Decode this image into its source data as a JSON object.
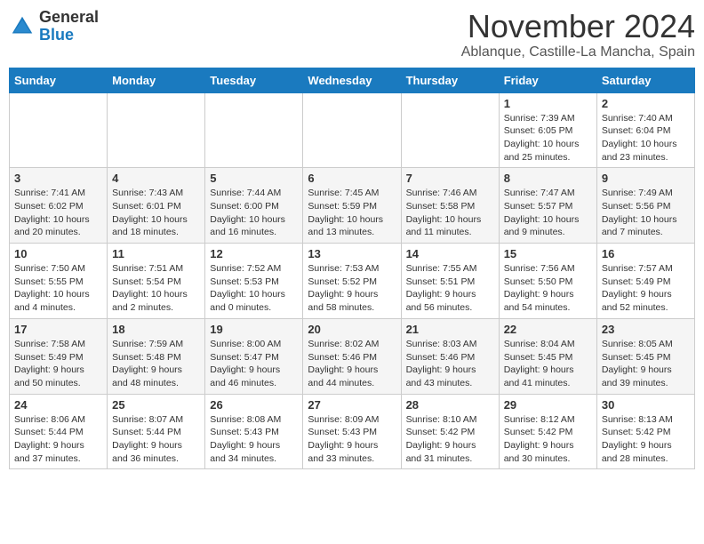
{
  "header": {
    "logo_general": "General",
    "logo_blue": "Blue",
    "month": "November 2024",
    "location": "Ablanque, Castille-La Mancha, Spain"
  },
  "weekdays": [
    "Sunday",
    "Monday",
    "Tuesday",
    "Wednesday",
    "Thursday",
    "Friday",
    "Saturday"
  ],
  "weeks": [
    [
      {
        "day": "",
        "info": ""
      },
      {
        "day": "",
        "info": ""
      },
      {
        "day": "",
        "info": ""
      },
      {
        "day": "",
        "info": ""
      },
      {
        "day": "",
        "info": ""
      },
      {
        "day": "1",
        "info": "Sunrise: 7:39 AM\nSunset: 6:05 PM\nDaylight: 10 hours and 25 minutes."
      },
      {
        "day": "2",
        "info": "Sunrise: 7:40 AM\nSunset: 6:04 PM\nDaylight: 10 hours and 23 minutes."
      }
    ],
    [
      {
        "day": "3",
        "info": "Sunrise: 7:41 AM\nSunset: 6:02 PM\nDaylight: 10 hours and 20 minutes."
      },
      {
        "day": "4",
        "info": "Sunrise: 7:43 AM\nSunset: 6:01 PM\nDaylight: 10 hours and 18 minutes."
      },
      {
        "day": "5",
        "info": "Sunrise: 7:44 AM\nSunset: 6:00 PM\nDaylight: 10 hours and 16 minutes."
      },
      {
        "day": "6",
        "info": "Sunrise: 7:45 AM\nSunset: 5:59 PM\nDaylight: 10 hours and 13 minutes."
      },
      {
        "day": "7",
        "info": "Sunrise: 7:46 AM\nSunset: 5:58 PM\nDaylight: 10 hours and 11 minutes."
      },
      {
        "day": "8",
        "info": "Sunrise: 7:47 AM\nSunset: 5:57 PM\nDaylight: 10 hours and 9 minutes."
      },
      {
        "day": "9",
        "info": "Sunrise: 7:49 AM\nSunset: 5:56 PM\nDaylight: 10 hours and 7 minutes."
      }
    ],
    [
      {
        "day": "10",
        "info": "Sunrise: 7:50 AM\nSunset: 5:55 PM\nDaylight: 10 hours and 4 minutes."
      },
      {
        "day": "11",
        "info": "Sunrise: 7:51 AM\nSunset: 5:54 PM\nDaylight: 10 hours and 2 minutes."
      },
      {
        "day": "12",
        "info": "Sunrise: 7:52 AM\nSunset: 5:53 PM\nDaylight: 10 hours and 0 minutes."
      },
      {
        "day": "13",
        "info": "Sunrise: 7:53 AM\nSunset: 5:52 PM\nDaylight: 9 hours and 58 minutes."
      },
      {
        "day": "14",
        "info": "Sunrise: 7:55 AM\nSunset: 5:51 PM\nDaylight: 9 hours and 56 minutes."
      },
      {
        "day": "15",
        "info": "Sunrise: 7:56 AM\nSunset: 5:50 PM\nDaylight: 9 hours and 54 minutes."
      },
      {
        "day": "16",
        "info": "Sunrise: 7:57 AM\nSunset: 5:49 PM\nDaylight: 9 hours and 52 minutes."
      }
    ],
    [
      {
        "day": "17",
        "info": "Sunrise: 7:58 AM\nSunset: 5:49 PM\nDaylight: 9 hours and 50 minutes."
      },
      {
        "day": "18",
        "info": "Sunrise: 7:59 AM\nSunset: 5:48 PM\nDaylight: 9 hours and 48 minutes."
      },
      {
        "day": "19",
        "info": "Sunrise: 8:00 AM\nSunset: 5:47 PM\nDaylight: 9 hours and 46 minutes."
      },
      {
        "day": "20",
        "info": "Sunrise: 8:02 AM\nSunset: 5:46 PM\nDaylight: 9 hours and 44 minutes."
      },
      {
        "day": "21",
        "info": "Sunrise: 8:03 AM\nSunset: 5:46 PM\nDaylight: 9 hours and 43 minutes."
      },
      {
        "day": "22",
        "info": "Sunrise: 8:04 AM\nSunset: 5:45 PM\nDaylight: 9 hours and 41 minutes."
      },
      {
        "day": "23",
        "info": "Sunrise: 8:05 AM\nSunset: 5:45 PM\nDaylight: 9 hours and 39 minutes."
      }
    ],
    [
      {
        "day": "24",
        "info": "Sunrise: 8:06 AM\nSunset: 5:44 PM\nDaylight: 9 hours and 37 minutes."
      },
      {
        "day": "25",
        "info": "Sunrise: 8:07 AM\nSunset: 5:44 PM\nDaylight: 9 hours and 36 minutes."
      },
      {
        "day": "26",
        "info": "Sunrise: 8:08 AM\nSunset: 5:43 PM\nDaylight: 9 hours and 34 minutes."
      },
      {
        "day": "27",
        "info": "Sunrise: 8:09 AM\nSunset: 5:43 PM\nDaylight: 9 hours and 33 minutes."
      },
      {
        "day": "28",
        "info": "Sunrise: 8:10 AM\nSunset: 5:42 PM\nDaylight: 9 hours and 31 minutes."
      },
      {
        "day": "29",
        "info": "Sunrise: 8:12 AM\nSunset: 5:42 PM\nDaylight: 9 hours and 30 minutes."
      },
      {
        "day": "30",
        "info": "Sunrise: 8:13 AM\nSunset: 5:42 PM\nDaylight: 9 hours and 28 minutes."
      }
    ]
  ]
}
